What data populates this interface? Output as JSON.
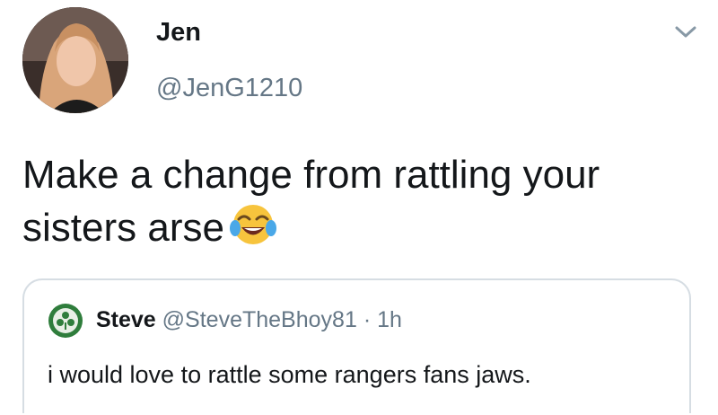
{
  "author": {
    "name": "Jen",
    "handle": "@JenG1210",
    "avatar_icon": "profile-photo"
  },
  "menu_icon": "chevron-down-icon",
  "tweet": {
    "text": "Make a change from rattling your sisters arse",
    "emoji": "face-with-tears-of-joy"
  },
  "quoted_tweet": {
    "name": "Steve",
    "handle": "@SteveTheBhoy81",
    "separator": "·",
    "time": "1h",
    "text": "i would love to rattle some rangers fans jaws.",
    "avatar_icon": "club-crest-icon"
  },
  "colors": {
    "text": "#14171a",
    "secondary": "#657786",
    "border": "#d6dde3",
    "emoji_yellow": "#f7c43d",
    "emoji_tear": "#4aa8e8",
    "crest_green": "#2f7d3c"
  }
}
